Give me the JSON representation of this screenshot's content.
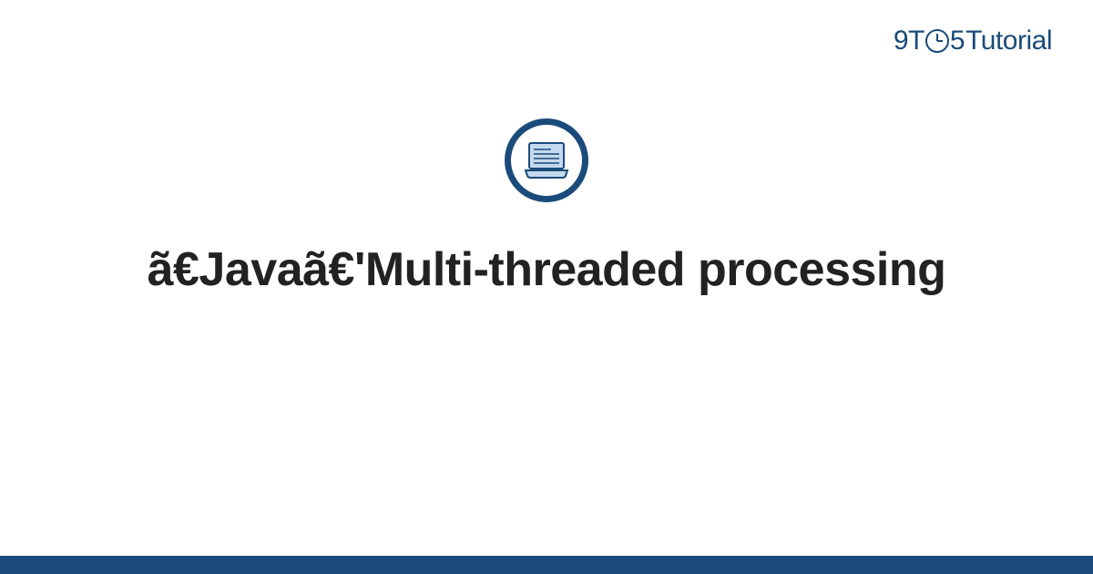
{
  "logo": {
    "prefix": "9T",
    "suffix": "5",
    "word": "Tutorial"
  },
  "title": "ã€Javaã€'Multi-threaded processing",
  "colors": {
    "brand": "#1a4b7a",
    "text": "#222222",
    "icon_fill": "#c5d9ee"
  }
}
